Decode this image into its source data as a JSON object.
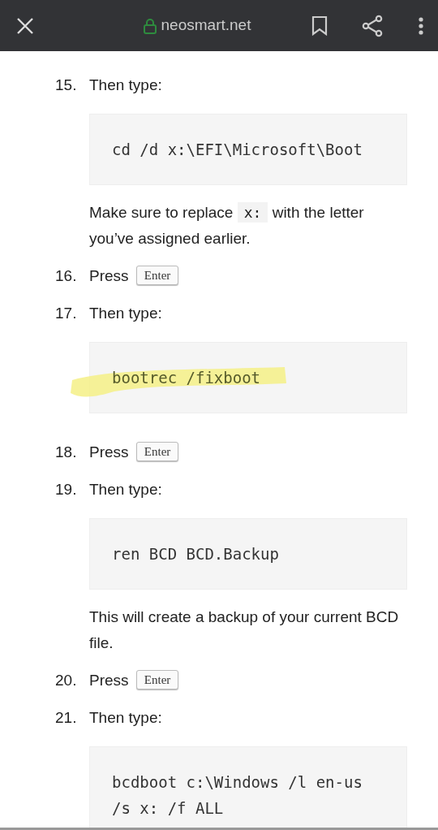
{
  "browser_bar": {
    "domain": "neosmart.net",
    "secure": true
  },
  "steps": [
    {
      "number": "15.",
      "text": "Then type:",
      "code": "cd /d x:\\EFI\\Microsoft\\Boot",
      "highlighted": false,
      "note": [
        {
          "kind": "text",
          "text": "Make sure to replace "
        },
        {
          "kind": "code",
          "text": "x:"
        },
        {
          "kind": "text",
          "text": " with the letter you’ve assigned earlier."
        }
      ]
    },
    {
      "number": "16.",
      "text": "Press",
      "key": "Enter"
    },
    {
      "number": "17.",
      "text": "Then type:",
      "code": "bootrec /fixboot",
      "highlighted": true
    },
    {
      "number": "18.",
      "text": "Press",
      "key": "Enter"
    },
    {
      "number": "19.",
      "text": "Then type:",
      "code": "ren BCD BCD.Backup",
      "highlighted": false,
      "note": [
        {
          "kind": "text",
          "text": "This will create a backup of your current BCD file."
        }
      ]
    },
    {
      "number": "20.",
      "text": "Press",
      "key": "Enter"
    },
    {
      "number": "21.",
      "text": "Then type:",
      "code": "bcdboot c:\\Windows /l en-us /s x: /f ALL",
      "highlighted": false
    }
  ]
}
